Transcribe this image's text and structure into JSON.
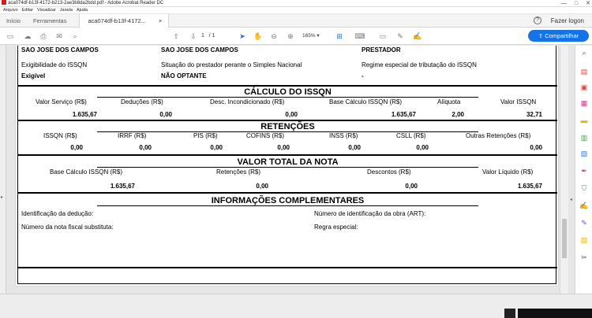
{
  "window": {
    "title": "aca074df-b13f-4172-b213-2ae3b8da2bdd.pdf - Adobe Acrobat Reader DC",
    "controls": [
      "—",
      "□",
      "✕"
    ]
  },
  "menu": [
    "Arquivo",
    "Editar",
    "Visualizar",
    "Janela",
    "Ajuda"
  ],
  "tabs": {
    "home": "Início",
    "tools": "Ferramentas",
    "document": "aca074df-b13f-4172...",
    "close": "×",
    "help": "?",
    "login": "Fazer logon"
  },
  "toolbar": {
    "page_current": "1",
    "page_total": "/ 1",
    "zoom": "165%",
    "share": "Compartilhar"
  },
  "document": {
    "top": {
      "col1_value": "SAO JOSE DOS CAMPOS",
      "col2_value": "SAO JOSE DOS CAMPOS",
      "col3_value": "PRESTADOR",
      "col1_label": "Exigibilidade do ISSQN",
      "col2_label": "Situação do prestador perante o Simples Nacional",
      "col3_label": "Regime especial de tributação do ISSQN",
      "col1_data": "Exigível",
      "col2_data": "NÃO OPTANTE",
      "col3_data": "-"
    },
    "calculo": {
      "title": "CÁLCULO DO ISSQN",
      "labels": [
        "Valor Serviço (R$)",
        "Deduções (R$)",
        "Desc. Incondicionado (R$)",
        "Base Cálculo ISSQN (R$)",
        "Alíquota",
        "Valor ISSQN"
      ],
      "values": [
        "1.635,67",
        "0,00",
        "0,00",
        "1.635,67",
        "2,00",
        "32,71"
      ]
    },
    "retencoes": {
      "title": "RETENÇÕES",
      "labels": [
        "ISSQN (R$)",
        "IRRF (R$)",
        "PIS (R$)",
        "COFINS (R$)",
        "INSS (R$)",
        "CSLL (R$)",
        "Outras Retenções (R$)"
      ],
      "values": [
        "0,00",
        "0,00",
        "0,00",
        "0,00",
        "0,00",
        "0,00",
        "0,00"
      ]
    },
    "total": {
      "title": "VALOR TOTAL DA NOTA",
      "labels": [
        "Base Cálculo ISSQN (R$)",
        "Retenções (R$)",
        "Descontos (R$)",
        "Valor Líquido (R$)"
      ],
      "values": [
        "1.635,67",
        "0,00",
        "0,00",
        "1.635,67"
      ]
    },
    "complementares": {
      "title": "INFORMAÇÕES COMPLEMENTARES",
      "left1": "Identificação da dedução:",
      "left2": "Número da nota fiscal substituta:",
      "right1": "Número de identificação da obra (ART):",
      "right2": "Regra especial:"
    }
  }
}
